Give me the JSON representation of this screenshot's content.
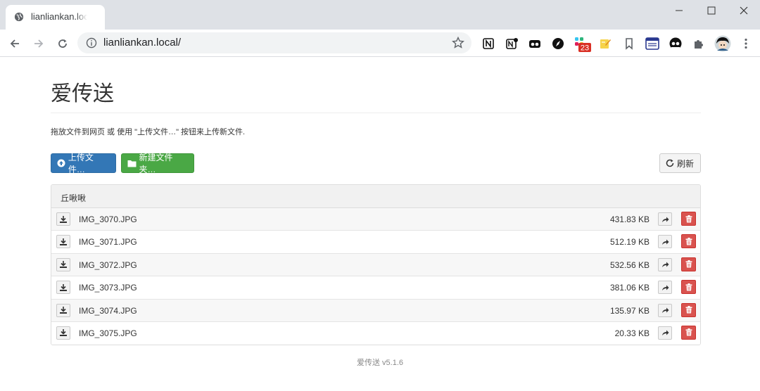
{
  "browser": {
    "tab_title": "lianliankan.local/",
    "url": "lianliankan.local/",
    "extension_badge": "23"
  },
  "page": {
    "title": "爱传送",
    "description": "拖放文件到网页 或 使用 \"上传文件…\" 按钮来上传新文件.",
    "buttons": {
      "upload": "上传文件…",
      "new_folder": "新建文件夹…",
      "refresh": "刷新"
    },
    "panel_header": "丘啾啾",
    "files": [
      {
        "name": "IMG_3070.JPG",
        "size": "431.83 KB"
      },
      {
        "name": "IMG_3071.JPG",
        "size": "512.19 KB"
      },
      {
        "name": "IMG_3072.JPG",
        "size": "532.56 KB"
      },
      {
        "name": "IMG_3073.JPG",
        "size": "381.06 KB"
      },
      {
        "name": "IMG_3074.JPG",
        "size": "135.97 KB"
      },
      {
        "name": "IMG_3075.JPG",
        "size": "20.33 KB"
      }
    ],
    "footer": "爱传送 v5.1.6"
  },
  "colors": {
    "upload_button": "#3377b6",
    "folder_button": "#4aa845",
    "delete_button": "#d9534f"
  }
}
